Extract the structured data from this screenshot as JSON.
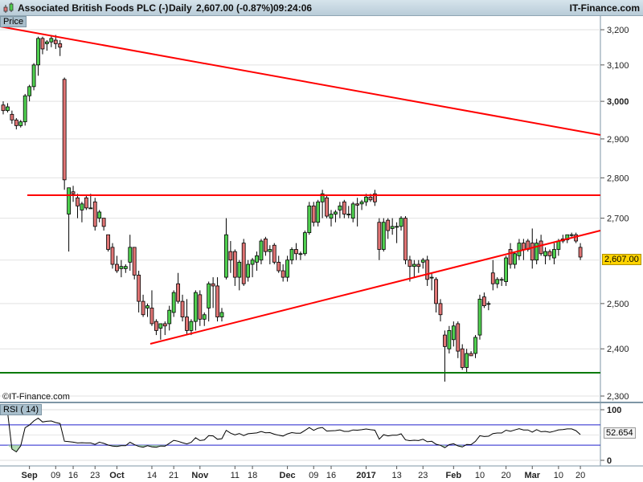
{
  "header": {
    "instrument": "Associated British Foods PLC (-)",
    "interval": "Daily",
    "quote": "2,607.00 (-0.87%)",
    "time": "09:24:06",
    "brand": "IT-Finance.com"
  },
  "panes": {
    "price_label": "Price",
    "rsi_label": "RSI ( 14)",
    "copyright": "©IT-Finance.com",
    "last_price": "2,607.00",
    "rsi_last": "52.654"
  },
  "colors": {
    "up": "#4fcf4f",
    "down": "#e07474",
    "trend": "#ff0000",
    "support": "#0a7a0a",
    "rsi_band": "#2222cc"
  },
  "chart_data": {
    "type": "candlestick",
    "title": "Associated British Foods PLC (-) Daily",
    "scale": "log",
    "ylim": [
      2300,
      3200
    ],
    "yticks": [
      "3,200",
      "3,100",
      "3,000",
      "2,900",
      "2,800",
      "2,700",
      "2,500",
      "2,400",
      "2,300"
    ],
    "ytick_values": [
      3200,
      3100,
      3000,
      2900,
      2800,
      2700,
      2500,
      2400,
      2300
    ],
    "xticks": [
      {
        "label": "Sep",
        "bold": true,
        "index": 6
      },
      {
        "label": "09",
        "index": 12
      },
      {
        "label": "16",
        "index": 16
      },
      {
        "label": "23",
        "index": 21
      },
      {
        "label": "Oct",
        "bold": true,
        "index": 26
      },
      {
        "label": "14",
        "index": 34
      },
      {
        "label": "21",
        "index": 39
      },
      {
        "label": "Nov",
        "bold": true,
        "index": 45
      },
      {
        "label": "11",
        "index": 53
      },
      {
        "label": "18",
        "index": 57
      },
      {
        "label": "Dec",
        "bold": true,
        "index": 65
      },
      {
        "label": "09",
        "index": 71
      },
      {
        "label": "16",
        "index": 75
      },
      {
        "label": "2017",
        "bold": true,
        "index": 83
      },
      {
        "label": "13",
        "index": 90
      },
      {
        "label": "23",
        "index": 96
      },
      {
        "label": "Feb",
        "bold": true,
        "index": 103
      },
      {
        "label": "10",
        "index": 109
      },
      {
        "label": "20",
        "index": 115
      },
      {
        "label": "Mar",
        "bold": true,
        "index": 121
      },
      {
        "label": "10",
        "index": 127
      },
      {
        "label": "20",
        "index": 132
      }
    ],
    "ohlc": [
      [
        2990,
        3000,
        2965,
        2975
      ],
      [
        2975,
        2995,
        2970,
        2985
      ],
      [
        2965,
        2975,
        2940,
        2950
      ],
      [
        2950,
        2955,
        2925,
        2935
      ],
      [
        2935,
        2950,
        2930,
        2945
      ],
      [
        2945,
        3020,
        2935,
        3015
      ],
      [
        3015,
        3045,
        3000,
        3040
      ],
      [
        3040,
        3105,
        3030,
        3100
      ],
      [
        3100,
        3180,
        3070,
        3175
      ],
      [
        3175,
        3180,
        3130,
        3145
      ],
      [
        3160,
        3170,
        3140,
        3165
      ],
      [
        3165,
        3185,
        3150,
        3175
      ],
      [
        3170,
        3185,
        3145,
        3160
      ],
      [
        3160,
        3170,
        3125,
        3150
      ],
      [
        3060,
        3065,
        2770,
        2795
      ],
      [
        2710,
        2775,
        2620,
        2775
      ],
      [
        2765,
        2780,
        2740,
        2760
      ],
      [
        2750,
        2760,
        2700,
        2730
      ],
      [
        2720,
        2740,
        2690,
        2735
      ],
      [
        2750,
        2755,
        2720,
        2725
      ],
      [
        2725,
        2760,
        2725,
        2725
      ],
      [
        2740,
        2750,
        2670,
        2680
      ],
      [
        2700,
        2720,
        2690,
        2715
      ],
      [
        2700,
        2700,
        2670,
        2680
      ],
      [
        2660,
        2660,
        2620,
        2625
      ],
      [
        2630,
        2640,
        2580,
        2590
      ],
      [
        2590,
        2610,
        2570,
        2575
      ],
      [
        2580,
        2600,
        2560,
        2585
      ],
      [
        2580,
        2590,
        2570,
        2585
      ],
      [
        2595,
        2660,
        2575,
        2630
      ],
      [
        2630,
        2630,
        2555,
        2565
      ],
      [
        2565,
        2575,
        2480,
        2505
      ],
      [
        2505,
        2520,
        2470,
        2475
      ],
      [
        2490,
        2500,
        2470,
        2495
      ],
      [
        2490,
        2530,
        2450,
        2455
      ],
      [
        2460,
        2465,
        2430,
        2440
      ],
      [
        2445,
        2455,
        2420,
        2455
      ],
      [
        2455,
        2460,
        2430,
        2450
      ],
      [
        2455,
        2495,
        2440,
        2485
      ],
      [
        2480,
        2530,
        2470,
        2525
      ],
      [
        2545,
        2570,
        2500,
        2505
      ],
      [
        2505,
        2520,
        2460,
        2470
      ],
      [
        2470,
        2510,
        2430,
        2440
      ],
      [
        2440,
        2465,
        2430,
        2460
      ],
      [
        2460,
        2530,
        2440,
        2525
      ],
      [
        2520,
        2530,
        2450,
        2465
      ],
      [
        2465,
        2480,
        2450,
        2475
      ],
      [
        2490,
        2550,
        2460,
        2545
      ],
      [
        2545,
        2560,
        2490,
        2540
      ],
      [
        2540,
        2560,
        2460,
        2470
      ],
      [
        2470,
        2490,
        2460,
        2480
      ],
      [
        2560,
        2700,
        2555,
        2660
      ],
      [
        2620,
        2645,
        2570,
        2600
      ],
      [
        2620,
        2625,
        2540,
        2560
      ],
      [
        2560,
        2600,
        2530,
        2595
      ],
      [
        2640,
        2650,
        2540,
        2545
      ],
      [
        2560,
        2600,
        2550,
        2590
      ],
      [
        2590,
        2605,
        2560,
        2600
      ],
      [
        2595,
        2620,
        2575,
        2610
      ],
      [
        2600,
        2650,
        2590,
        2645
      ],
      [
        2650,
        2655,
        2610,
        2620
      ],
      [
        2620,
        2635,
        2590,
        2625
      ],
      [
        2635,
        2640,
        2590,
        2595
      ],
      [
        2595,
        2610,
        2570,
        2575
      ],
      [
        2575,
        2590,
        2550,
        2560
      ],
      [
        2560,
        2610,
        2550,
        2600
      ],
      [
        2600,
        2630,
        2590,
        2625
      ],
      [
        2625,
        2640,
        2600,
        2615
      ],
      [
        2615,
        2620,
        2600,
        2615
      ],
      [
        2615,
        2670,
        2610,
        2665
      ],
      [
        2665,
        2740,
        2660,
        2730
      ],
      [
        2730,
        2740,
        2680,
        2690
      ],
      [
        2690,
        2745,
        2680,
        2740
      ],
      [
        2740,
        2770,
        2700,
        2760
      ],
      [
        2750,
        2755,
        2700,
        2705
      ],
      [
        2700,
        2720,
        2680,
        2710
      ],
      [
        2710,
        2720,
        2690,
        2715
      ],
      [
        2720,
        2740,
        2700,
        2730
      ],
      [
        2740,
        2745,
        2700,
        2710
      ],
      [
        2710,
        2730,
        2700,
        2710
      ],
      [
        2700,
        2740,
        2690,
        2735
      ],
      [
        2735,
        2750,
        2680,
        2732
      ],
      [
        2735,
        2745,
        2720,
        2740
      ],
      [
        2740,
        2760,
        2730,
        2752
      ],
      [
        2752,
        2760,
        2740,
        2745
      ],
      [
        2760,
        2770,
        2730,
        2740
      ],
      [
        2690,
        2700,
        2600,
        2625
      ],
      [
        2625,
        2700,
        2620,
        2690
      ],
      [
        2695,
        2700,
        2650,
        2670
      ],
      [
        2675,
        2700,
        2660,
        2680
      ],
      [
        2680,
        2690,
        2640,
        2680
      ],
      [
        2680,
        2705,
        2670,
        2700
      ],
      [
        2700,
        2705,
        2590,
        2600
      ],
      [
        2600,
        2610,
        2550,
        2585
      ],
      [
        2585,
        2600,
        2560,
        2590
      ],
      [
        2590,
        2600,
        2570,
        2585
      ],
      [
        2595,
        2605,
        2580,
        2600
      ],
      [
        2600,
        2610,
        2540,
        2555
      ],
      [
        2560,
        2570,
        2530,
        2560
      ],
      [
        2555,
        2560,
        2480,
        2500
      ],
      [
        2500,
        2510,
        2460,
        2475
      ],
      [
        2430,
        2440,
        2330,
        2405
      ],
      [
        2400,
        2450,
        2390,
        2440
      ],
      [
        2420,
        2460,
        2405,
        2450
      ],
      [
        2455,
        2460,
        2380,
        2395
      ],
      [
        2400,
        2410,
        2355,
        2360
      ],
      [
        2360,
        2400,
        2350,
        2390
      ],
      [
        2390,
        2395,
        2385,
        2385
      ],
      [
        2390,
        2430,
        2380,
        2425
      ],
      [
        2430,
        2520,
        2420,
        2510
      ],
      [
        2515,
        2525,
        2490,
        2495
      ],
      [
        2500,
        2505,
        2485,
        2500
      ],
      [
        2570,
        2600,
        2530,
        2545
      ],
      [
        2545,
        2560,
        2535,
        2555
      ],
      [
        2555,
        2560,
        2540,
        2555
      ],
      [
        2550,
        2610,
        2540,
        2605
      ],
      [
        2625,
        2640,
        2580,
        2590
      ],
      [
        2590,
        2620,
        2580,
        2615
      ],
      [
        2610,
        2650,
        2600,
        2640
      ],
      [
        2640,
        2650,
        2600,
        2625
      ],
      [
        2645,
        2650,
        2620,
        2625
      ],
      [
        2640,
        2675,
        2580,
        2600
      ],
      [
        2600,
        2650,
        2590,
        2640
      ],
      [
        2645,
        2660,
        2610,
        2615
      ],
      [
        2610,
        2630,
        2590,
        2620
      ],
      [
        2620,
        2625,
        2600,
        2610
      ],
      [
        2605,
        2640,
        2590,
        2625
      ],
      [
        2625,
        2650,
        2610,
        2645
      ],
      [
        2645,
        2660,
        2640,
        2650
      ],
      [
        2648,
        2660,
        2640,
        2660
      ],
      [
        2660,
        2665,
        2655,
        2660
      ],
      [
        2660,
        2665,
        2640,
        2645
      ],
      [
        2630,
        2640,
        2600,
        2607
      ]
    ],
    "rsi": {
      "period": 14,
      "ylim": [
        0,
        100
      ],
      "bands": [
        30,
        70
      ],
      "yticks": [
        "100",
        "0"
      ],
      "last": 52.654
    }
  }
}
